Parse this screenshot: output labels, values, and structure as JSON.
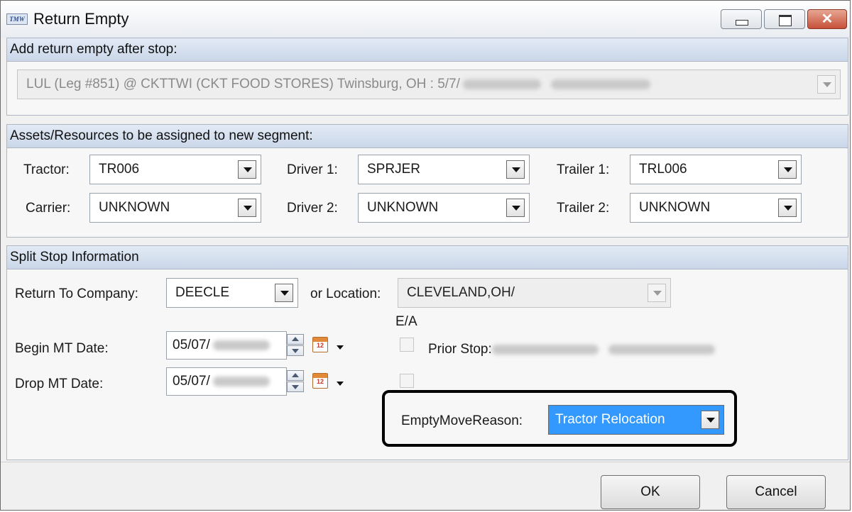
{
  "window": {
    "title": "Return Empty",
    "app_icon": "TMW"
  },
  "section_after_stop": {
    "header": "Add return empty after stop:",
    "stop_select_value": "LUL (Leg #851) @ CKTTWI (CKT FOOD STORES) Twinsburg, OH : 5/7/"
  },
  "section_assets": {
    "header": "Assets/Resources to be assigned to new segment:",
    "tractor_label": "Tractor:",
    "tractor_value": "TR006",
    "carrier_label": "Carrier:",
    "carrier_value": "UNKNOWN",
    "driver1_label": "Driver 1:",
    "driver1_value": "SPRJER",
    "driver2_label": "Driver 2:",
    "driver2_value": "UNKNOWN",
    "trailer1_label": "Trailer 1:",
    "trailer1_value": "TRL006",
    "trailer2_label": "Trailer 2:",
    "trailer2_value": "UNKNOWN"
  },
  "section_split": {
    "header": "Split Stop Information",
    "return_company_label": "Return To Company:",
    "return_company_value": "DEECLE",
    "location_label": "or Location:",
    "location_value": "CLEVELAND,OH/",
    "ea_label": "E/A",
    "begin_label": "Begin MT Date:",
    "begin_value": "05/07/",
    "drop_label": "Drop MT Date:",
    "drop_value": "05/07/",
    "prior_stop_label": "Prior Stop:",
    "calendar_day": "12",
    "reason_label": "EmptyMoveReason:",
    "reason_value": "Tractor Relocation"
  },
  "buttons": {
    "ok": "OK",
    "cancel": "Cancel"
  },
  "colors": {
    "header_gradient": "#cad7e9",
    "selected": "#3399ff",
    "close_button": "#c7503a"
  }
}
